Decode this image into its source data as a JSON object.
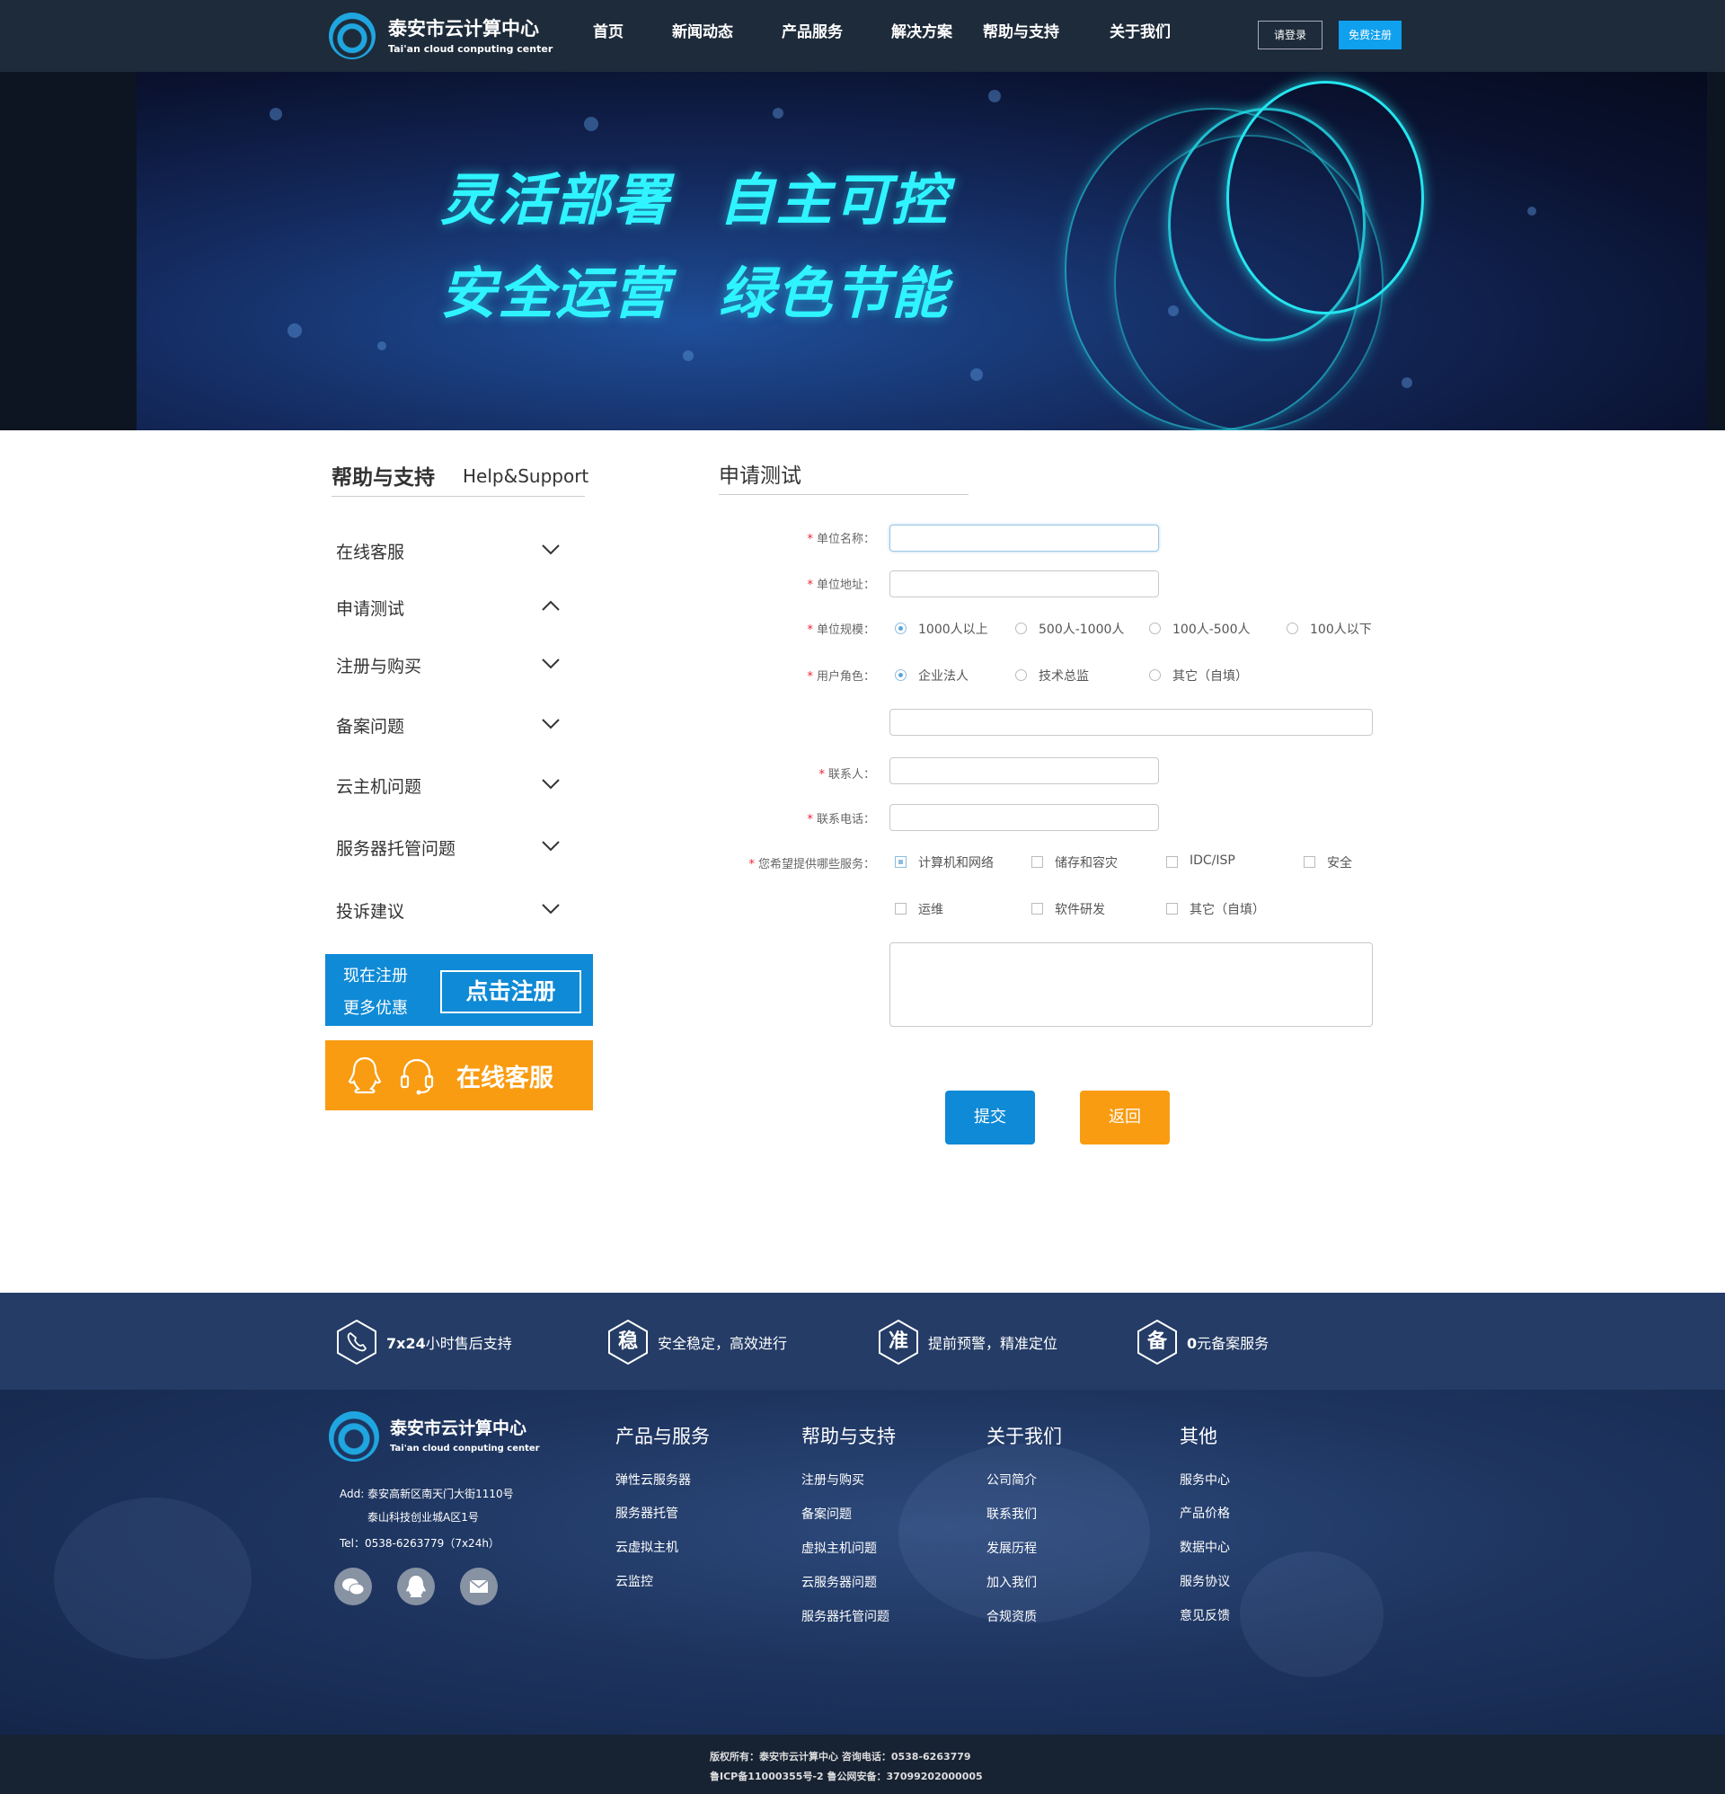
{
  "header": {
    "logo_cn": "泰安市云计算中心",
    "logo_en": "Tai'an cloud conputing center",
    "nav": [
      "首页",
      "新闻动态",
      "产品服务",
      "解决方案",
      "帮助与支持",
      "关于我们"
    ],
    "login_label": "请登录",
    "register_label": "免费注册"
  },
  "banner": {
    "line1_left": "灵活部署",
    "line1_right": "自主可控",
    "line2_left": "安全运营",
    "line2_right": "绿色节能"
  },
  "sidebar": {
    "title": "帮助与支持",
    "subtitle": "Help&Support",
    "items": [
      {
        "label": "在线客服",
        "expanded": false
      },
      {
        "label": "申请测试",
        "expanded": true
      },
      {
        "label": "注册与购买",
        "expanded": false
      },
      {
        "label": "备案问题",
        "expanded": false
      },
      {
        "label": "云主机问题",
        "expanded": false
      },
      {
        "label": "服务器托管问题",
        "expanded": false
      },
      {
        "label": "投诉建议",
        "expanded": false
      }
    ],
    "promo_register": {
      "line1": "现在注册",
      "line2": "更多优惠",
      "button": "点击注册"
    },
    "promo_service": {
      "label": "在线客服"
    }
  },
  "form": {
    "title": "申请测试",
    "required_mark": "*",
    "labels": {
      "org_name": "单位名称：",
      "org_address": "单位地址：",
      "org_size": "单位规模：",
      "user_role": "用户角色：",
      "contact": "联系人：",
      "phone": "联系电话：",
      "services": "您希望提供哪些服务："
    },
    "org_size_options": [
      {
        "label": "1000人以上",
        "selected": true
      },
      {
        "label": "500人-1000人",
        "selected": false
      },
      {
        "label": "100人-500人",
        "selected": false
      },
      {
        "label": "100人以下",
        "selected": false
      }
    ],
    "role_options": [
      {
        "label": "企业法人",
        "selected": true
      },
      {
        "label": "技术总监",
        "selected": false
      },
      {
        "label": "其它（自填）",
        "selected": false
      }
    ],
    "service_options": [
      {
        "label": "计算机和网络",
        "checked": true
      },
      {
        "label": "储存和容灾",
        "checked": false
      },
      {
        "label": "IDC/ISP",
        "checked": false
      },
      {
        "label": "安全",
        "checked": false
      },
      {
        "label": "运维",
        "checked": false
      },
      {
        "label": "软件研发",
        "checked": false
      },
      {
        "label": "其它（自填）",
        "checked": false
      }
    ],
    "submit_label": "提交",
    "back_label": "返回"
  },
  "features": [
    {
      "icon": "phone-icon",
      "char": "",
      "text_bold": "7x24",
      "text": "小时售后支持"
    },
    {
      "icon": "stable-icon",
      "char": "稳",
      "text_bold": "",
      "text": "安全稳定，高效进行"
    },
    {
      "icon": "accurate-icon",
      "char": "准",
      "text_bold": "",
      "text": "提前预警，精准定位"
    },
    {
      "icon": "record-icon",
      "char": "备",
      "text_bold": "0",
      "text": "元备案服务"
    }
  ],
  "footer": {
    "logo_cn": "泰安市云计算中心",
    "logo_en": "Tai'an cloud conputing center",
    "address1": "Add: 泰安高新区南天门大街1110号",
    "address2": "泰山科技创业城A区1号",
    "tel": "Tel：0538-6263779（7x24h）",
    "columns": [
      {
        "title": "产品与服务",
        "links": [
          "弹性云服务器",
          "服务器托管",
          "云虚拟主机",
          "云监控"
        ]
      },
      {
        "title": "帮助与支持",
        "links": [
          "注册与购买",
          "备案问题",
          "虚拟主机问题",
          "云服务器问题",
          "服务器托管问题"
        ]
      },
      {
        "title": "关于我们",
        "links": [
          "公司简介",
          "联系我们",
          "发展历程",
          "加入我们",
          "合规资质"
        ]
      },
      {
        "title": "其他",
        "links": [
          "服务中心",
          "产品价格",
          "数据中心",
          "服务协议",
          "意见反馈"
        ]
      }
    ]
  },
  "copyright": {
    "line1": "版权所有：泰安市云计算中心    咨询电话：0538-6263779",
    "line2": "鲁ICP备11000355号-2        鲁公网安备：37099202000005"
  },
  "colors": {
    "brand_blue": "#0f8ad6",
    "accent_orange": "#f99c12",
    "header_bg": "#1e2b3a",
    "slogan_cyan": "#2ff4ff"
  }
}
